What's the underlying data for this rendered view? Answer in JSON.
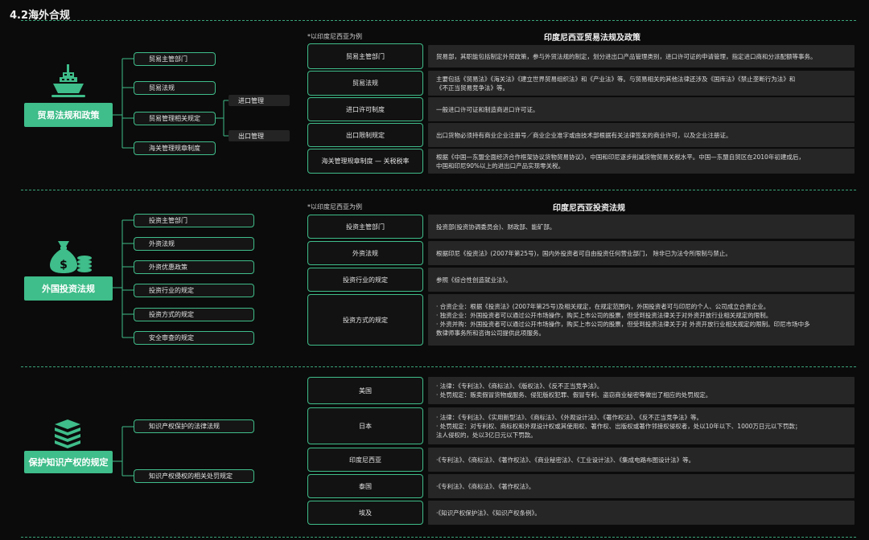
{
  "page_title": "4.2海外合规",
  "colors": {
    "accent": "#3fbd8a",
    "background": "#0b0b0b",
    "panel": "#262626"
  },
  "section1": {
    "category": "贸易法规和政策",
    "icon": "ship-icon",
    "branches": [
      "贸易主管部门",
      "贸易法规",
      "贸易管理相关规定",
      "海关管理规章制度"
    ],
    "sub_branches": [
      "进口管理",
      "出口管理"
    ],
    "note": "*以印度尼西亚为例",
    "heading": "印度尼西亚贸易法规及政策",
    "rows": [
      {
        "key": "贸易主管部门",
        "lines": [
          "贸易部，其职能包括制定外贸政策，参与外贸法规的制定，划分进出口产品管理类别，进口许可证的申请管理，指定进口商和分派配额等事务。"
        ]
      },
      {
        "key": "贸易法规",
        "lines": [
          "主要包括《贸易法》《海关法》《建立世界贸易组织法》和《产业法》等。与贸易相关的其他法律还涉及《国库法》《禁止垄断行为法》和",
          "《不正当贸易竞争法》等。"
        ]
      },
      {
        "key": "进口许可制度",
        "lines": [
          "一般进口许可证和制造商进口许可证。"
        ]
      },
      {
        "key": "出口限制规定",
        "lines": [
          "出口货物必须持有商业企业注册号／商业企业准字或由技术部根据有关法律签发的商业许可，以及企业注册证。"
        ]
      },
      {
        "key": "海关管理规章制度 — 关税税率",
        "lines": [
          "根据《中国—东盟全面经济合作框架协议货物贸易协议》，中国和印尼逐步削减货物贸易关税水平。中国—东盟自贸区在2010年初建成后，",
          "中国和印尼90%以上的进出口产品实现零关税。"
        ]
      }
    ]
  },
  "section2": {
    "category": "外国投资法规",
    "icon": "money-bag-icon",
    "branches": [
      "投资主管部门",
      "外资法规",
      "外资优惠政策",
      "投资行业的规定",
      "投资方式的规定",
      "安全审查的规定"
    ],
    "note": "*以印度尼西亚为例",
    "heading": "印度尼西亚投资法规",
    "rows": [
      {
        "key": "投资主管部门",
        "lines": [
          "投资部(投资协调委员会)、财政部、能矿部。"
        ]
      },
      {
        "key": "外资法规",
        "lines": [
          "根据印尼《投资法》(2007年第25号)，国内外投资者可自由投资任何营业部门， 除非已为法令所限制与禁止。"
        ]
      },
      {
        "key": "投资行业的规定",
        "lines": [
          "参照《综合性创造就业法》。"
        ]
      },
      {
        "key": "投资方式的规定",
        "lines": [
          "· 合资企业：根据《投资法》(2007年第25号)及相关规定，在规定范围内，外国投资者可与印尼的个人、公司成立合资企业。",
          "· 独资企业：外国投资者可以通过公开市场操作，购买上市公司的股票，但受到投资法律关于对外资开放行业相关规定的限制。",
          "· 外资并购：外国投资者可以通过公开市场操作，购买上市公司的股票，但受到投资法律关于对 外资开放行业相关规定的限制。印尼市场中多",
          "  数律师事务所和咨询公司提供此项服务。"
        ]
      }
    ]
  },
  "section3": {
    "category": "保护知识产权的规定",
    "icon": "books-icon",
    "branches": [
      "知识产权保护的法律法规",
      "知识产权侵权的相关处罚规定"
    ],
    "rows": [
      {
        "key": "美国",
        "lines": [
          "· 法律：《专利法》、《商标法》、《版权法》、《反不正当竞争法》。",
          "· 处罚规定：贩卖假冒货物或服务、侵犯版权犯罪、假冒专利、盗窃商业秘密等做出了相应的处罚规定。"
        ]
      },
      {
        "key": "日本",
        "lines": [
          "· 法律：《专利法》、《实用新型法》、《商标法》、《外观设计法》、《著作权法》、《反不正当竞争法》等。",
          "· 处罚规定：对专利权、商标权和外观设计权或其使用权、著作权、出版权或著作邻接权侵权者，处以10年以下、1000万日元以下罚款；",
          "  法人侵权的，处以3亿日元以下罚款。"
        ]
      },
      {
        "key": "印度尼西亚",
        "lines": [
          "·《专利法》、《商标法》、《著作权法》、《商业秘密法》、《工业设计法》、《集成电路布图设计法》等。"
        ]
      },
      {
        "key": "泰国",
        "lines": [
          "·《专利法》、《商标法》、《著作权法》。"
        ]
      },
      {
        "key": "埃及",
        "lines": [
          "·《知识产权保护法》、《知识产权条例》。"
        ]
      }
    ]
  }
}
